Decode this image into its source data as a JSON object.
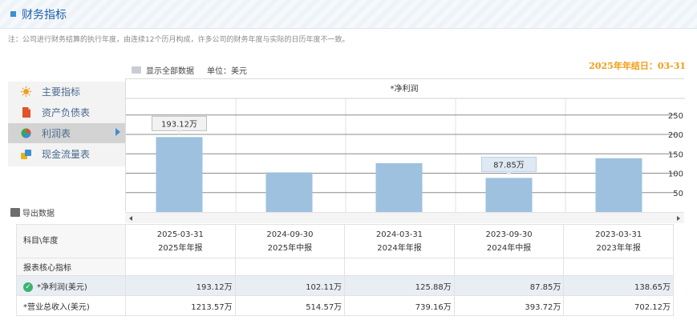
{
  "header": {
    "title": "财务指标"
  },
  "note": "注：公司进行财务结算的执行年度，由连续12个历月构成，许多公司的财务年度与实际的日历年度不一致。",
  "toolbar": {
    "show_all": "显示全部数据",
    "unit": "单位：美元",
    "fy_end": "2025年年结日：03-31"
  },
  "sidebar": {
    "items": [
      {
        "label": "主要指标",
        "icon": "sun-icon",
        "color": "#f0a020"
      },
      {
        "label": "资产负债表",
        "icon": "document-icon",
        "color": "#e0522b"
      },
      {
        "label": "利润表",
        "icon": "pie-chart-icon",
        "color": "#3aa655",
        "active": true
      },
      {
        "label": "现金流量表",
        "icon": "money-bag-icon",
        "color": "#e6b21c"
      }
    ]
  },
  "export_label": "导出数据",
  "chart_data": {
    "type": "bar",
    "title": "*净利润",
    "categories": [
      "2025-03-31",
      "2024-09-30",
      "2024-03-31",
      "2023-09-30",
      "2023-03-31"
    ],
    "values": [
      193.12,
      102.11,
      125.88,
      87.85,
      138.65
    ],
    "ylim": [
      0,
      250
    ],
    "yticks": [
      "50",
      "100",
      "150",
      "200",
      "250"
    ],
    "callouts": [
      {
        "index": 0,
        "text": "193.12万"
      },
      {
        "index": 3,
        "text": "87.85万"
      }
    ],
    "bar_color": "#9dc1df",
    "grid": true
  },
  "table": {
    "corner": "科目\\年度",
    "columns": [
      {
        "date": "2025-03-31",
        "report": "2025年年报"
      },
      {
        "date": "2024-09-30",
        "report": "2025年中报"
      },
      {
        "date": "2024-03-31",
        "report": "2024年年报"
      },
      {
        "date": "2023-09-30",
        "report": "2024年中报"
      },
      {
        "date": "2023-03-31",
        "report": "2023年年报"
      }
    ],
    "section": "报表核心指标",
    "rows": [
      {
        "label": "*净利润(美元)",
        "values": [
          "193.12万",
          "102.11万",
          "125.88万",
          "87.85万",
          "138.65万"
        ]
      },
      {
        "label": "*营业总收入(美元)",
        "values": [
          "1213.57万",
          "514.57万",
          "739.16万",
          "393.72万",
          "702.12万"
        ]
      }
    ]
  }
}
